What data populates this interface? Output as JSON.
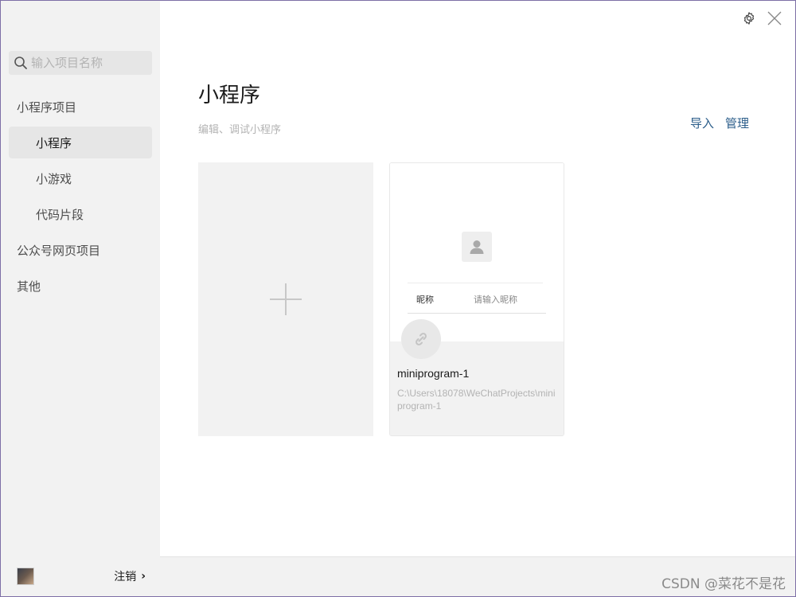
{
  "search": {
    "placeholder": "输入项目名称"
  },
  "sidebar": {
    "items": [
      {
        "label": "小程序项目"
      },
      {
        "label": "小程序"
      },
      {
        "label": "小游戏"
      },
      {
        "label": "代码片段"
      },
      {
        "label": "公众号网页项目"
      },
      {
        "label": "其他"
      }
    ],
    "logout_label": "注销",
    "logout_chevron": "›"
  },
  "main": {
    "title": "小程序",
    "subtitle": "编辑、调试小程序",
    "import_label": "导入",
    "manage_label": "管理"
  },
  "project": {
    "name": "miniprogram-1",
    "path": "C:\\Users\\18078\\WeChatProjects\\miniprogram-1",
    "preview": {
      "nickname_label": "昵称",
      "nickname_placeholder": "请输入昵称"
    }
  },
  "watermark": "CSDN @菜花不是花",
  "icons": {
    "settings": "gear-icon",
    "close": "close-icon",
    "search": "search-icon",
    "add": "plus-icon",
    "project": "link-icon"
  },
  "colors": {
    "link": "#2b5d8a",
    "sidebar_bg": "#f2f2f2",
    "active_bg": "#e6e6e6"
  }
}
